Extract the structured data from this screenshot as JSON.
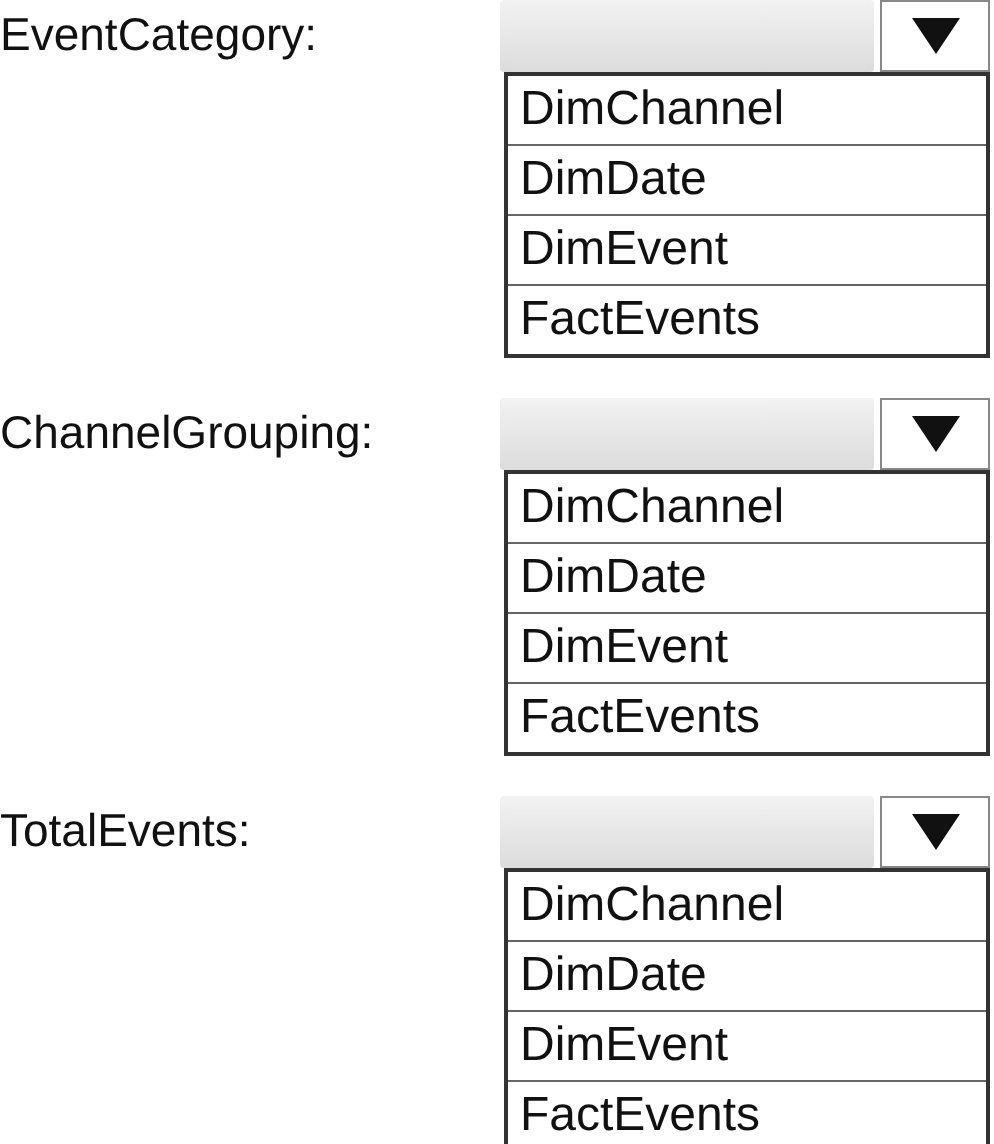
{
  "fields": [
    {
      "label": "EventCategory:",
      "options": [
        "DimChannel",
        "DimDate",
        "DimEvent",
        "FactEvents"
      ]
    },
    {
      "label": "ChannelGrouping:",
      "options": [
        "DimChannel",
        "DimDate",
        "DimEvent",
        "FactEvents"
      ]
    },
    {
      "label": "TotalEvents:",
      "options": [
        "DimChannel",
        "DimDate",
        "DimEvent",
        "FactEvents"
      ]
    }
  ]
}
